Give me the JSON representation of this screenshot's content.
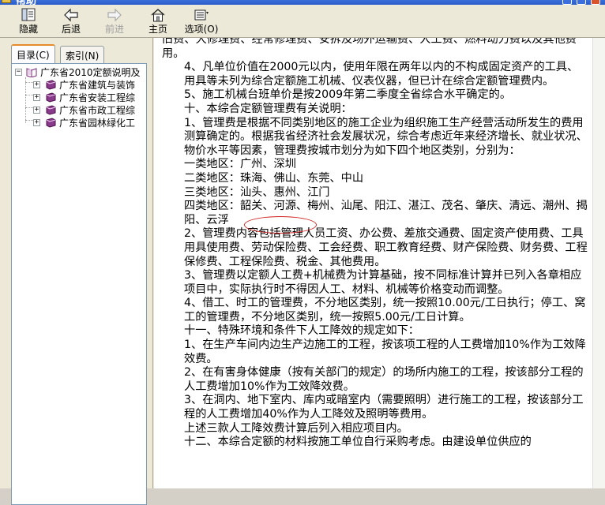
{
  "window": {
    "title": "帮助"
  },
  "toolbar": {
    "items": [
      {
        "label": "隐藏",
        "icon": "hide-icon"
      },
      {
        "label": "后退",
        "icon": "back-arrow-icon"
      },
      {
        "label": "前进",
        "icon": "forward-arrow-icon",
        "disabled": true
      },
      {
        "label": "主页",
        "icon": "home-icon"
      },
      {
        "label": "选项(O)",
        "icon": "options-icon"
      }
    ]
  },
  "sidebar": {
    "tabs": [
      {
        "label": "目录(C)",
        "active": true
      },
      {
        "label": "索引(N)",
        "active": false
      }
    ],
    "tree": [
      {
        "label": "广东省2010定额说明及",
        "expander": "−",
        "icon": "open-book-icon"
      },
      {
        "label": "广东省建筑与装饰",
        "expander": "+",
        "icon": "closed-book-icon"
      },
      {
        "label": "广东省安装工程综",
        "expander": "+",
        "icon": "closed-book-icon"
      },
      {
        "label": "广东省市政工程综",
        "expander": "+",
        "icon": "closed-book-icon"
      },
      {
        "label": "广东省园林绿化工",
        "expander": "+",
        "icon": "closed-book-icon"
      }
    ]
  },
  "content": {
    "paragraphs": [
      "旧费、大修理费、经常修理费、安拆及场外运输费、人工费、燃料动力费以及其他费用。",
      "4、凡单位价值在2000元以内，使用年限在两年以内的不构成固定资产的工具、用具等未列为综合定额施工机械、仪表仪器，但已计在综合定额管理费内。",
      "5、施工机械台班单价是按2009年第二季度全省综合水平确定的。",
      "十、本综合定额管理费有关说明：",
      "1、管理费是根据不同类别地区的施工企业为组织施工生产经营活动所发生的费用测算确定的。根据我省经济社会发展状况，综合考虑近年来经济增长、就业状况、物价水平等因素，管理费按城市划分为如下四个地区类别，分别为：",
      "一类地区：广州、深圳",
      "二类地区：珠海、佛山、东莞、中山",
      "三类地区：汕头、惠州、江门",
      "四类地区：韶关、河源、梅州、汕尾、阳江、湛江、茂名、肇庆、清远、潮州、揭阳、云浮",
      "2、管理费内容包括管理人员工资、办公费、差旅交通费、固定资产使用费、工具用具使用费、劳动保险费、工会经费、职工教育经费、财产保险费、财务费、工程保修费、工程保险费、税金、其他费用。",
      "3、管理费以定额人工费+机械费为计算基础，按不同标准计算并已列入各章相应项目中，实际执行时不得因人工、材料、机械等价格变动而调整。",
      "4、借工、时工的管理费，不分地区类别，统一按照10.00元/工日执行；停工、窝工的管理费，不分地区类别，统一按照5.00元/工日计算。",
      "十一、特殊环境和条件下人工降效的规定如下：",
      "1、在生产车间内边生产边施工的工程，按该项工程的人工费增加10%作为工效降效费。",
      "2、在有害身体健康（按有关部门的规定）的场所内施工的工程，按该部分工程的人工费增加10%作为工效降效费。",
      "3、在洞内、地下室内、库内或暗室内（需要照明）进行施工的工程，按该部分工程的人工费增加40%作为人工降效及照明等费用。",
      "上述三款人工降效费计算后列入相应项目内。",
      "十二、本综合定额的材料按施工单位自行采购考虑。由建设单位供应的"
    ]
  },
  "colors": {
    "annotation": "#d02020",
    "book": "#7a2a7a"
  }
}
